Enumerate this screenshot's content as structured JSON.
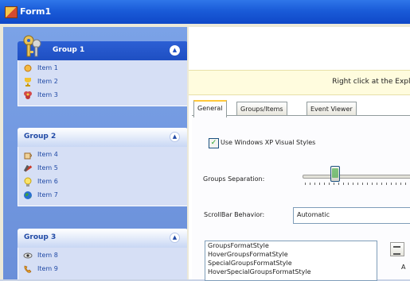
{
  "window": {
    "title": "Form1"
  },
  "explorer": {
    "groups": [
      {
        "title": "Group 1",
        "special": true,
        "items": [
          {
            "label": "Item 1",
            "icon": "sun-icon"
          },
          {
            "label": "Item 2",
            "icon": "trophy-icon"
          },
          {
            "label": "Item 3",
            "icon": "flower-icon"
          }
        ]
      },
      {
        "title": "Group 2",
        "special": false,
        "items": [
          {
            "label": "Item 4",
            "icon": "coffee-icon"
          },
          {
            "label": "Item 5",
            "icon": "tools-icon"
          },
          {
            "label": "Item 6",
            "icon": "lightbulb-icon"
          },
          {
            "label": "Item 7",
            "icon": "globe-icon"
          }
        ]
      },
      {
        "title": "Group 3",
        "special": false,
        "items": [
          {
            "label": "Item 8",
            "icon": "eye-icon"
          },
          {
            "label": "Item 9",
            "icon": "phone-icon"
          }
        ]
      }
    ]
  },
  "banner": {
    "text": "Right click at the Explo"
  },
  "tabs": [
    "General",
    "Groups/Items",
    "Event Viewer"
  ],
  "general": {
    "visual_styles_label": "Use Windows XP Visual Styles",
    "visual_styles_checked": true,
    "groups_separation_label": "Groups Separation:",
    "scrollbar_label": "ScrollBar Behavior:",
    "scrollbar_value": "Automatic",
    "format_styles": [
      "GroupsFormatStyle",
      "HoverGroupsFormatStyle",
      "SpecialGroupsFormatStyle",
      "HoverSpecialGroupsFormatStyle"
    ],
    "side_label": "A"
  },
  "colors": {
    "titlebar": "#1a5bd8",
    "explorer_bg": "#6a8fd9",
    "special_header": "#1e4fc2",
    "banner_bg": "#fffcde",
    "item_text": "#214aa5"
  }
}
